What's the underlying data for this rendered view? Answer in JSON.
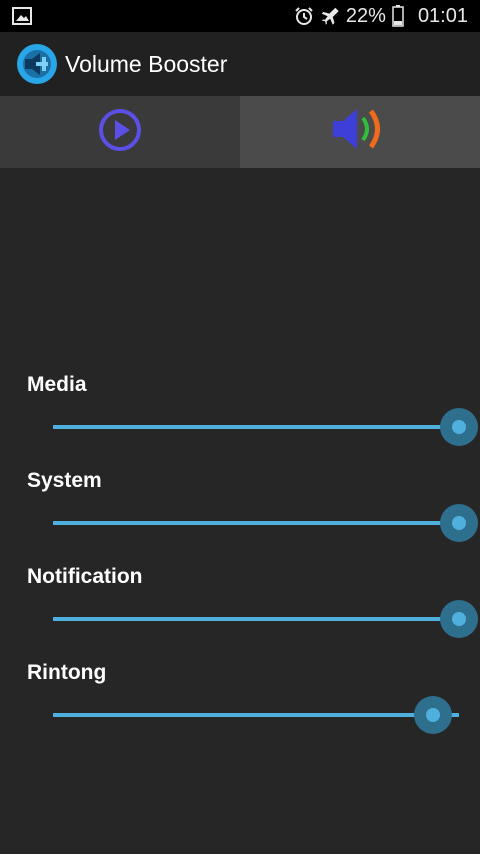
{
  "status_bar": {
    "battery_percent": "22%",
    "time": "01:01",
    "icons": [
      "gallery-icon",
      "alarm-icon",
      "airplane-mode-icon",
      "battery-icon"
    ]
  },
  "app_bar": {
    "title": "Volume Booster",
    "logo_icon": "volume-booster-logo-icon"
  },
  "tabs": [
    {
      "name": "player",
      "icon": "play-circle-icon",
      "selected": false
    },
    {
      "name": "volume",
      "icon": "speaker-waves-icon",
      "selected": true
    }
  ],
  "sliders": [
    {
      "label": "Media",
      "value": 1.0
    },
    {
      "label": "System",
      "value": 1.0
    },
    {
      "label": "Notification",
      "value": 1.0
    },
    {
      "label": "Rintong",
      "value": 0.935
    }
  ],
  "colors": {
    "accent": "#4fb0dd",
    "thumb_halo": "#2f6f8e",
    "play_icon": "#5b4fe6",
    "speaker_body": "#3d3fd6",
    "wave_inner": "#2fbf3a",
    "wave_outer": "#f06a1c"
  }
}
